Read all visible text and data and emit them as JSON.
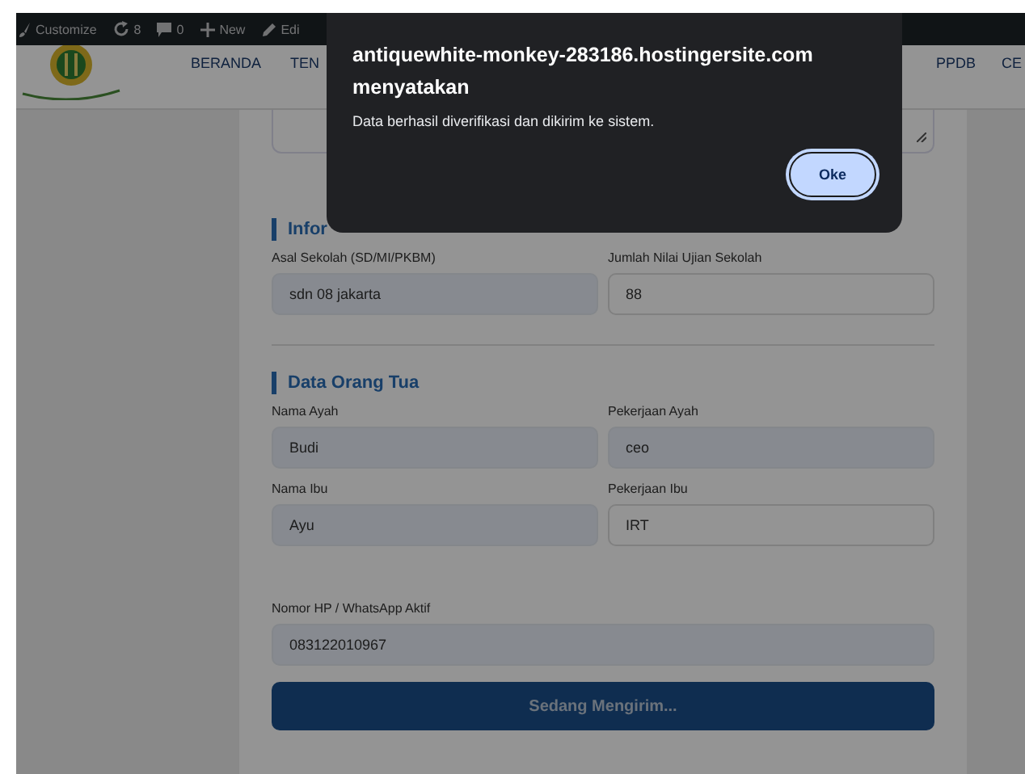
{
  "admin_bar": {
    "items": [
      {
        "kind": "customize",
        "label": "Customize"
      },
      {
        "kind": "updates",
        "label": "8"
      },
      {
        "kind": "comments",
        "label": "0"
      },
      {
        "kind": "new",
        "label": "New"
      },
      {
        "kind": "edit",
        "label": "Edi"
      }
    ]
  },
  "nav": {
    "left": [
      "BERANDA",
      "TEN"
    ],
    "right": [
      "PPDB",
      "CE"
    ]
  },
  "sections": [
    {
      "title": "Infor",
      "fields": [
        {
          "label": "Asal Sekolah (SD/MI/PKBM)",
          "value": "sdn 08 jakarta",
          "autofilled": true
        },
        {
          "label": "Jumlah Nilai Ujian Sekolah",
          "value": "88",
          "autofilled": false
        }
      ]
    },
    {
      "title": "Data Orang Tua",
      "fields": [
        {
          "label": "Nama Ayah",
          "value": "Budi",
          "autofilled": true
        },
        {
          "label": "Pekerjaan Ayah",
          "value": "ceo",
          "autofilled": true
        },
        {
          "label": "Nama Ibu",
          "value": "Ayu",
          "autofilled": true
        },
        {
          "label": "Pekerjaan Ibu",
          "value": "IRT",
          "autofilled": false
        }
      ]
    }
  ],
  "phone": {
    "label": "Nomor HP / WhatsApp Aktif",
    "value": "083122010967",
    "autofilled": true
  },
  "submit": {
    "label": "Sedang Mengirim...",
    "disabled": true
  },
  "dialog": {
    "title": "antiquewhite-monkey-283186.hostingersite.com menyatakan",
    "message": "Data berhasil diverifikasi dan dikirim ke sistem.",
    "button": "Oke"
  }
}
